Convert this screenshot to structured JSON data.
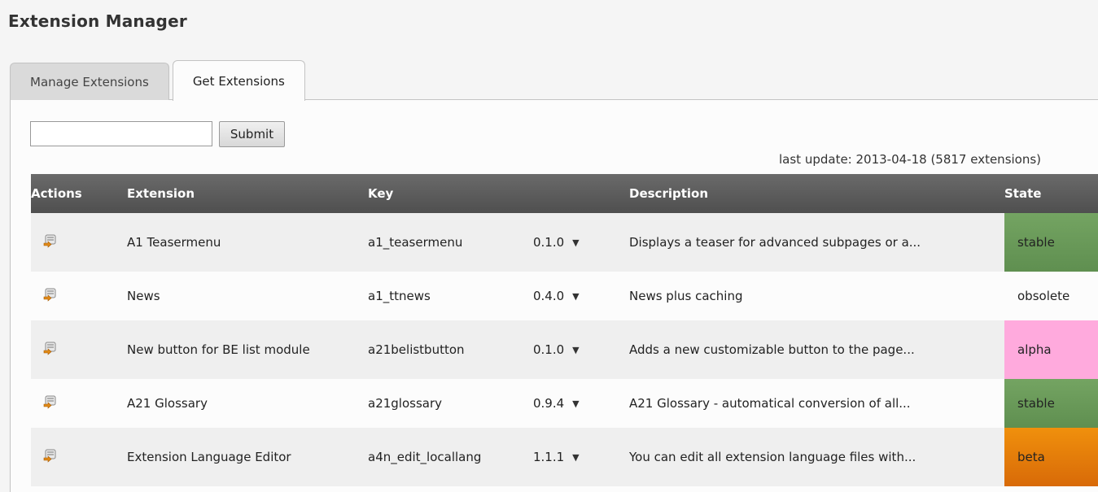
{
  "page": {
    "title": "Extension Manager"
  },
  "tabs": [
    {
      "label": "Manage Extensions",
      "active": false
    },
    {
      "label": "Get Extensions",
      "active": true
    }
  ],
  "search": {
    "value": "",
    "submit_label": "Submit"
  },
  "last_update": "last update: 2013-04-18 (5817 extensions)",
  "table": {
    "headers": [
      "Actions",
      "Extension",
      "Key",
      "Description",
      "State"
    ],
    "rows": [
      {
        "name": "A1 Teasermenu",
        "key": "a1_teasermenu",
        "version": "0.1.0",
        "description": "Displays a teaser for advanced subpages or a...",
        "state": "stable"
      },
      {
        "name": "News",
        "key": "a1_ttnews",
        "version": "0.4.0",
        "description": "News plus caching",
        "state": "obsolete"
      },
      {
        "name": "New button for BE list module",
        "key": "a21belistbutton",
        "version": "0.1.0",
        "description": "Adds a new customizable button to the page...",
        "state": "alpha"
      },
      {
        "name": "A21 Glossary",
        "key": "a21glossary",
        "version": "0.9.4",
        "description": "A21 Glossary - automatical conversion of all...",
        "state": "stable"
      },
      {
        "name": "Extension Language Editor",
        "key": "a4n_edit_locallang",
        "version": "1.1.1",
        "description": "You can edit all extension language files with...",
        "state": "beta"
      }
    ]
  },
  "icons": {
    "action": "import-extension-icon",
    "version_dropdown": "caret-down-icon"
  },
  "colors": {
    "header_bg": "#595959",
    "state_stable": "#6b9a5a",
    "state_alpha": "#ffaadd",
    "state_beta": "#e87c0c",
    "state_obsolete": "transparent"
  }
}
